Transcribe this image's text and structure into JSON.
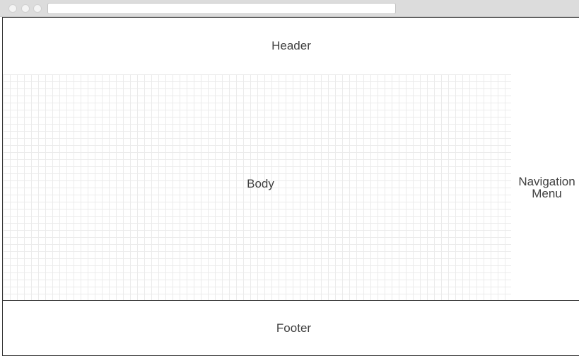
{
  "wireframe": {
    "header_label": "Header",
    "body_label": "Body",
    "nav_label_line1": "Navigation",
    "nav_label_line2": "Menu",
    "footer_label": "Footer"
  }
}
